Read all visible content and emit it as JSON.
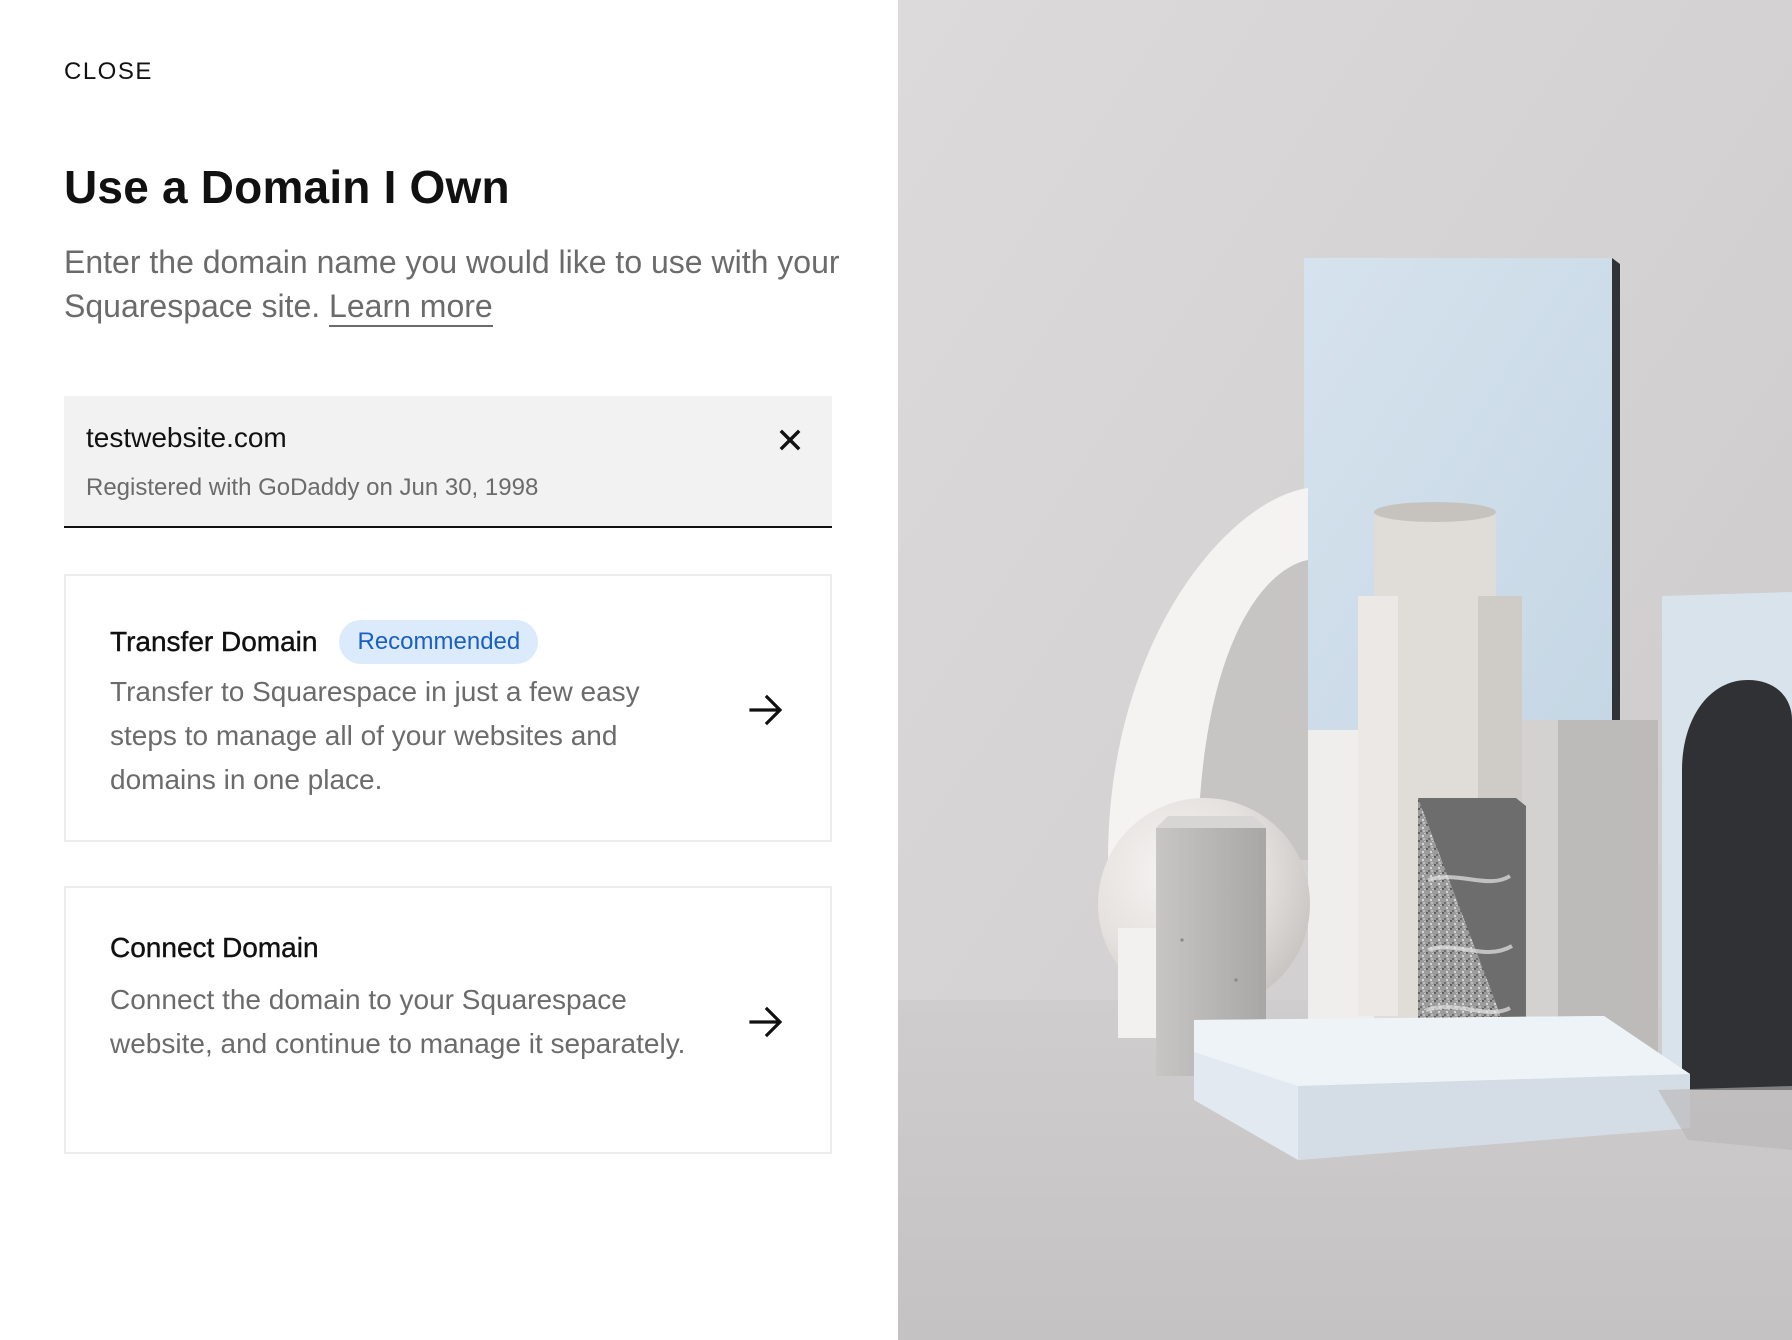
{
  "dialog": {
    "close_label": "CLOSE",
    "title": "Use a Domain I Own",
    "subtitle": "Enter the domain name you would like to use with your Squarespace site.",
    "learn_more": "Learn more"
  },
  "domain_field": {
    "value": "testwebsite.com",
    "registration_info": "Registered with GoDaddy on Jun 30, 1998",
    "clear_icon": "close-icon"
  },
  "options": [
    {
      "title": "Transfer Domain",
      "badge": "Recommended",
      "description": "Transfer to Squarespace in just a few easy steps to manage all of your websites and domains in one place.",
      "icon": "arrow-right-icon"
    },
    {
      "title": "Connect Domain",
      "description": "Connect the domain to your Squarespace website, and continue to manage it separately.",
      "icon": "arrow-right-icon"
    }
  ],
  "colors": {
    "text_primary": "#111111",
    "text_secondary": "#6b6b6b",
    "field_background": "#f2f2f2",
    "badge_background": "#dcebfb",
    "badge_text": "#1a5fc4",
    "card_border": "#ececec"
  }
}
